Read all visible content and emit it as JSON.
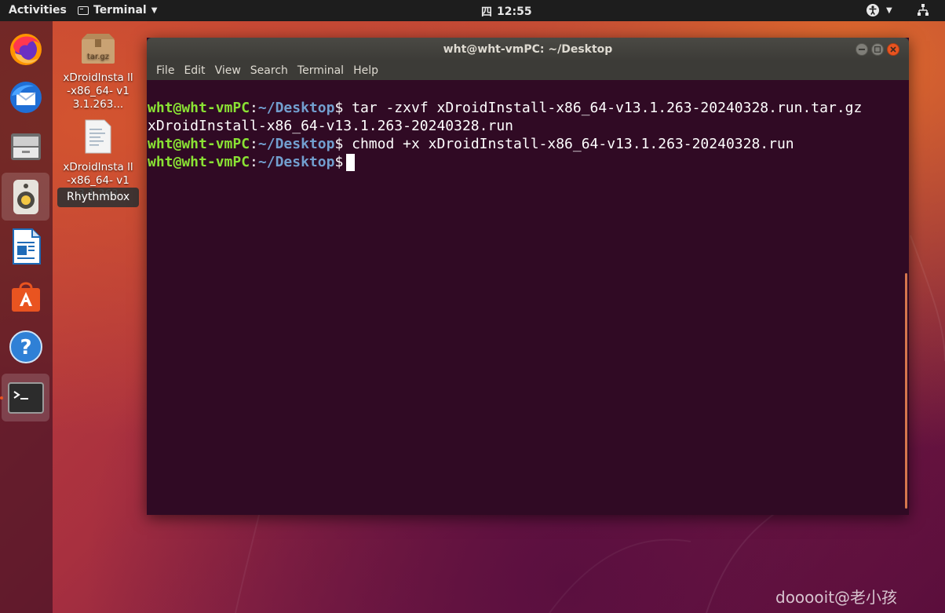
{
  "topbar": {
    "activities": "Activities",
    "app_menu": "Terminal",
    "clock_icon": "四",
    "time": "12:55"
  },
  "dock": {
    "items": [
      {
        "name": "firefox",
        "icon": "firefox-icon"
      },
      {
        "name": "thunderbird",
        "icon": "thunderbird-icon"
      },
      {
        "name": "files",
        "icon": "files-icon"
      },
      {
        "name": "rhythmbox",
        "icon": "rhythmbox-icon"
      },
      {
        "name": "writer",
        "icon": "libreoffice-writer-icon"
      },
      {
        "name": "software",
        "icon": "software-center-icon"
      },
      {
        "name": "help",
        "icon": "help-icon"
      },
      {
        "name": "terminal",
        "icon": "terminal-icon"
      }
    ],
    "tooltip": "Rhythmbox"
  },
  "desktop": {
    "icons": [
      {
        "label": "xDroidInsta ll-x86_64- v13.1.263...",
        "icon_text": "tar.gz"
      },
      {
        "label": "xDroidInsta ll-x86_64- v13.1.263"
      }
    ]
  },
  "window": {
    "title": "wht@wht-vmPC: ~/Desktop",
    "menu": [
      "File",
      "Edit",
      "View",
      "Search",
      "Terminal",
      "Help"
    ]
  },
  "terminal": {
    "prompt_user": "wht@wht-vmPC",
    "prompt_sep": ":",
    "prompt_path": "~/Desktop",
    "prompt_end": "$",
    "cmd1": " tar -zxvf xDroidInstall-x86_64-v13.1.263-20240328.run.tar.gz",
    "out1": "xDroidInstall-x86_64-v13.1.263-20240328.run",
    "cmd2": " chmod +x xDroidInstall-x86_64-v13.1.263-20240328.run"
  },
  "watermark": "dooooit@老小孩",
  "colors": {
    "accent": "#e95420",
    "terminal_bg": "#300a24",
    "prompt_user": "#8ae234",
    "prompt_path": "#729fcf"
  }
}
